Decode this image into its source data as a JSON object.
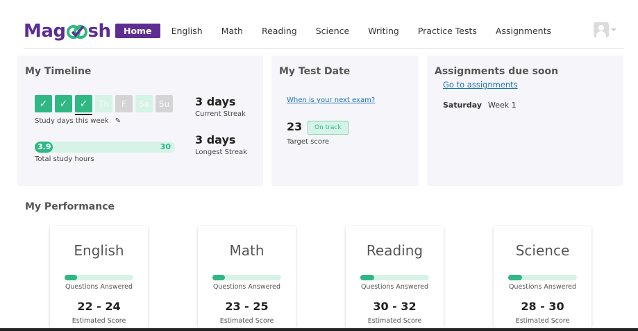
{
  "brand": {
    "logo_left": "Mag",
    "logo_right": "sh",
    "accent": "#5e2d91",
    "green": "#2fb884"
  },
  "nav": {
    "items": [
      {
        "label": "Home",
        "active": true
      },
      {
        "label": "English"
      },
      {
        "label": "Math"
      },
      {
        "label": "Reading"
      },
      {
        "label": "Science"
      },
      {
        "label": "Writing"
      },
      {
        "label": "Practice Tests"
      },
      {
        "label": "Assignments"
      }
    ],
    "user_icon": "user-avatar-icon"
  },
  "timeline": {
    "title": "My Timeline",
    "days": [
      {
        "label": "✓",
        "status": "done"
      },
      {
        "label": "✓",
        "status": "done"
      },
      {
        "label": "✓",
        "status": "done"
      },
      {
        "label": "Th",
        "status": "future"
      },
      {
        "label": "F",
        "status": "past"
      },
      {
        "label": "Sa",
        "status": "future"
      },
      {
        "label": "Su",
        "status": "past"
      }
    ],
    "study_days_label": "Study days this week",
    "edit_icon": "✎",
    "hours_value": "3.9",
    "hours_goal": "30",
    "hours_fraction": 0.13,
    "hours_label": "Total study hours",
    "current_streak": "3 days",
    "current_streak_label": "Current Streak",
    "longest_streak": "3 days",
    "longest_streak_label": "Longest Streak"
  },
  "test_date": {
    "title": "My Test Date",
    "next_exam_link": "When is your next exam?",
    "target_score": "23",
    "status_badge": "On track",
    "target_label": "Target score"
  },
  "assignments": {
    "title": "Assignments due soon",
    "link": "Go to assignments",
    "day": "Saturday",
    "week": "Week 1"
  },
  "performance": {
    "title": "My Performance",
    "subjects": [
      {
        "name": "English",
        "answered_fraction": 0.18,
        "answered_label": "Questions Answered",
        "score": "22 - 24",
        "score_label": "Estimated Score"
      },
      {
        "name": "Math",
        "answered_fraction": 0.18,
        "answered_label": "Questions Answered",
        "score": "23 - 25",
        "score_label": "Estimated Score"
      },
      {
        "name": "Reading",
        "answered_fraction": 0.2,
        "answered_label": "Questions Answered",
        "score": "30 - 32",
        "score_label": "Estimated Score"
      },
      {
        "name": "Science",
        "answered_fraction": 0.2,
        "answered_label": "Questions Answered",
        "score": "28 - 30",
        "score_label": "Estimated Score"
      }
    ]
  }
}
